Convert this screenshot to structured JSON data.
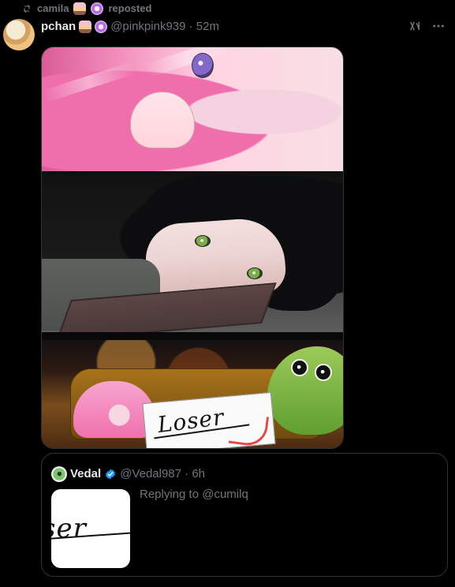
{
  "repost": {
    "user": "camila",
    "action": "reposted"
  },
  "post": {
    "display_name": "pchan",
    "handle_time": "@pinkpink939 · 52m"
  },
  "media": {
    "sign_text": "Loser"
  },
  "quoted": {
    "display_name": "Vedal",
    "handle_time": "@Vedal987 · 6h",
    "replying_to": "Replying to @cumilq",
    "thumb_text": "ser"
  },
  "icons": {
    "repost": "repost-icon",
    "grok": "grok-icon",
    "more": "more-icon",
    "verified": "verified-icon",
    "flower_badge": "flower-badge-icon",
    "mini_avatar_badge": "mini-avatar-badge-icon"
  },
  "colors": {
    "background": "#000000",
    "text_primary": "#e7e9ea",
    "text_secondary": "#71767b",
    "verified": "#1d9bf0",
    "border": "#2f3336"
  }
}
